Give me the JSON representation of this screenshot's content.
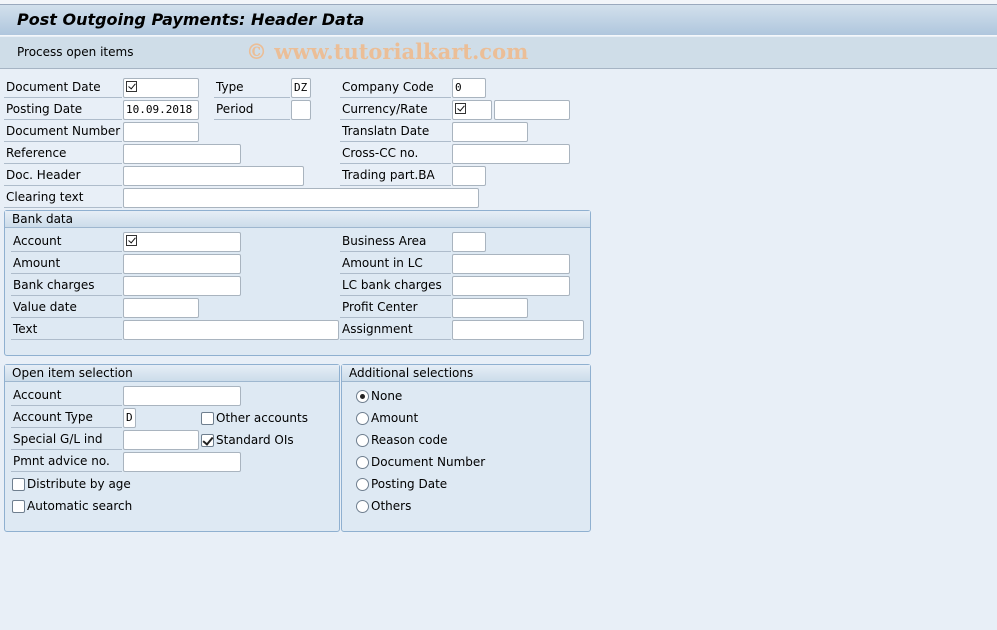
{
  "header": {
    "title": "Post Outgoing Payments: Header Data"
  },
  "toolbar": {
    "process_open_items": "Process open items",
    "watermark": "© www.tutorialkart.com"
  },
  "header_fields": {
    "document_date": {
      "label": "Document Date",
      "value": ""
    },
    "type": {
      "label": "Type",
      "value": "DZ"
    },
    "company_code": {
      "label": "Company Code",
      "value": "0"
    },
    "posting_date": {
      "label": "Posting Date",
      "value": "10.09.2018"
    },
    "period": {
      "label": "Period",
      "value": ""
    },
    "currency_rate": {
      "label": "Currency/Rate",
      "value": "",
      "rate": ""
    },
    "document_number": {
      "label": "Document Number",
      "value": ""
    },
    "translatn_date": {
      "label": "Translatn Date",
      "value": ""
    },
    "reference": {
      "label": "Reference",
      "value": ""
    },
    "cross_cc_no": {
      "label": "Cross-CC no.",
      "value": ""
    },
    "doc_header": {
      "label": "Doc. Header",
      "value": ""
    },
    "trading_part_ba": {
      "label": "Trading part.BA",
      "value": ""
    },
    "clearing_text": {
      "label": "Clearing text",
      "value": ""
    }
  },
  "bank_data": {
    "title": "Bank data",
    "account": {
      "label": "Account",
      "value": ""
    },
    "business_area": {
      "label": "Business Area",
      "value": ""
    },
    "amount": {
      "label": "Amount",
      "value": ""
    },
    "amount_in_lc": {
      "label": "Amount in LC",
      "value": ""
    },
    "bank_charges": {
      "label": "Bank charges",
      "value": ""
    },
    "lc_bank_charges": {
      "label": "LC bank charges",
      "value": ""
    },
    "value_date": {
      "label": "Value date",
      "value": ""
    },
    "profit_center": {
      "label": "Profit Center",
      "value": ""
    },
    "text": {
      "label": "Text",
      "value": ""
    },
    "assignment": {
      "label": "Assignment",
      "value": ""
    }
  },
  "open_item_selection": {
    "title": "Open item selection",
    "account": {
      "label": "Account",
      "value": ""
    },
    "account_type": {
      "label": "Account Type",
      "value": "D"
    },
    "other_accounts": {
      "label": "Other accounts",
      "checked": false
    },
    "special_gl_ind": {
      "label": "Special G/L ind",
      "value": ""
    },
    "standard_ois": {
      "label": "Standard OIs",
      "checked": true
    },
    "pmnt_advice_no": {
      "label": "Pmnt advice no.",
      "value": ""
    },
    "distribute_by_age": {
      "label": "Distribute by age",
      "checked": false
    },
    "automatic_search": {
      "label": "Automatic search",
      "checked": false
    }
  },
  "additional_selections": {
    "title": "Additional selections",
    "selected": "None",
    "options": [
      "None",
      "Amount",
      "Reason code",
      "Document Number",
      "Posting Date",
      "Others"
    ]
  }
}
